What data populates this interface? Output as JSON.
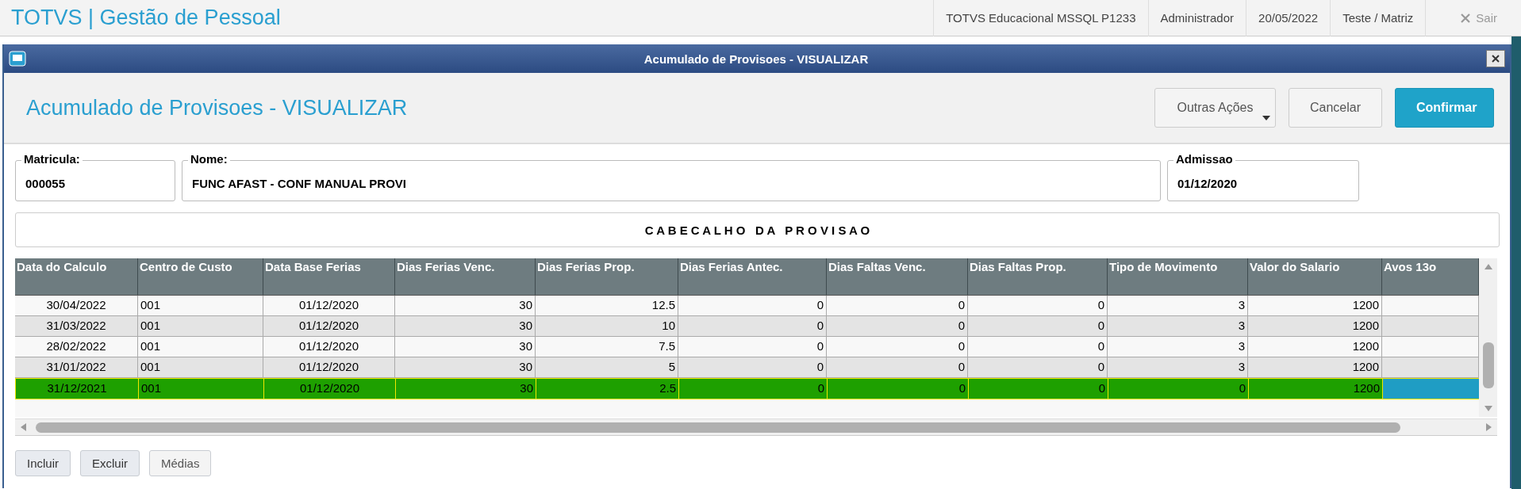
{
  "app": {
    "title": "TOTVS | Gestão de Pessoal",
    "status_items": [
      "TOTVS Educacional MSSQL P1233",
      "Administrador",
      "20/05/2022",
      "Teste / Matriz"
    ],
    "logout": "Sair"
  },
  "window": {
    "title": "Acumulado de Provisoes - VISUALIZAR"
  },
  "header": {
    "title": "Acumulado de Provisoes - VISUALIZAR",
    "buttons": [
      {
        "label": "Outras Ações",
        "kind": "menu"
      },
      {
        "label": "Cancelar",
        "kind": "plain"
      },
      {
        "label": "Confirmar",
        "kind": "primary"
      }
    ]
  },
  "fields": [
    {
      "label": "Matricula:",
      "value": "000055"
    },
    {
      "label": "Nome:",
      "value": "FUNC AFAST - CONF MANUAL PROVI"
    },
    {
      "label": "Admissao",
      "value": "01/12/2020"
    }
  ],
  "section_title": "C A B E C A L H O   D A   P R O V I S A O",
  "table": {
    "columns": [
      "Data do Calculo",
      "Centro de Custo",
      "Data Base Ferias",
      "Dias Ferias Venc.",
      "Dias Ferias Prop.",
      "Dias Ferias Antec.",
      "Dias Faltas Venc.",
      "Dias Faltas Prop.",
      "Tipo de Movimento",
      "Valor do Salario",
      "Avos 13o"
    ],
    "rows": [
      {
        "selected": false,
        "cells": [
          "30/04/2022",
          "001",
          "01/12/2020",
          "30",
          "12.5",
          "0",
          "0",
          "0",
          "3",
          "1200"
        ]
      },
      {
        "selected": false,
        "cells": [
          "31/03/2022",
          "001",
          "01/12/2020",
          "30",
          "10",
          "0",
          "0",
          "0",
          "3",
          "1200"
        ]
      },
      {
        "selected": false,
        "cells": [
          "28/02/2022",
          "001",
          "01/12/2020",
          "30",
          "7.5",
          "0",
          "0",
          "0",
          "3",
          "1200"
        ]
      },
      {
        "selected": false,
        "cells": [
          "31/01/2022",
          "001",
          "01/12/2020",
          "30",
          "5",
          "0",
          "0",
          "0",
          "3",
          "1200"
        ]
      },
      {
        "selected": true,
        "cells": [
          "31/12/2021",
          "001",
          "01/12/2020",
          "30",
          "2.5",
          "0",
          "0",
          "0",
          "0",
          "1200"
        ]
      }
    ]
  },
  "footer_buttons": [
    {
      "label": "Incluir",
      "disabled": false
    },
    {
      "label": "Excluir",
      "disabled": false
    },
    {
      "label": "Médias",
      "disabled": true
    }
  ]
}
